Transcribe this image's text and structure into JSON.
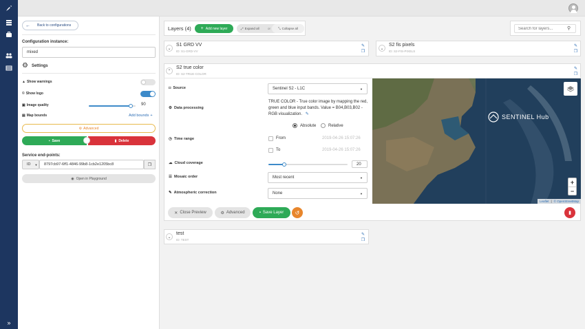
{
  "nav": {
    "icons": [
      "rocket-icon",
      "grid-icon",
      "briefcase-icon",
      "users-icon",
      "table-icon",
      "double-chevron-right-icon"
    ]
  },
  "left": {
    "back_label": "Back to configurations",
    "config_label": "Configuration instance:",
    "config_value": "mixed",
    "settings_label": "Settings",
    "show_warnings": "Show warnings",
    "show_logo": "Show logo",
    "image_quality": "Image quality",
    "image_quality_value": "90",
    "image_quality_fraction": 0.9,
    "map_bounds": "Map bounds",
    "add_bounds": "Add bounds",
    "advanced": "Advanced",
    "save": "Save",
    "delete": "Delete",
    "endpoints_label": "Service end-points:",
    "endpoint_type": "ID",
    "endpoint_value": "8797cb97-6ff1-4846-99b8-1cb2e1205bc8",
    "open_playground": "Open in Playground"
  },
  "header": {
    "layers_title": "Layers (4)",
    "add_layer": "Add new layer",
    "expand_all": "Expand all",
    "or": "or",
    "collapse_all": "Collapse all",
    "search_placeholder": "Search for layers..."
  },
  "layers": [
    {
      "title": "S1 GRD VV",
      "id": "ID: S1-GRD-VV"
    },
    {
      "title": "S2 fis pixels",
      "id": "ID: S2-FIS-PIXELS"
    },
    {
      "title": "S2 true color",
      "id": "ID: S2-TRUE-COLOR"
    },
    {
      "title": "test",
      "id": "ID: TEST"
    }
  ],
  "detail": {
    "source_label": "Source",
    "source_value": "Sentinel S2 - L1C",
    "data_processing_label": "Data processing",
    "data_processing_text": "TRUE COLOR - True color image by mapping the red, green and blue input bands. Value = B04,B03,B02 - RGB visualization.",
    "absolute": "Absolute",
    "relative": "Relative",
    "time_range_label": "Time range",
    "from_label": "From",
    "from_value": "2019-04-26 15:07:26",
    "to_label": "To",
    "to_value": "2019-04-26 15:07:26",
    "cloud_label": "Cloud coverage",
    "cloud_value": "20",
    "cloud_fraction": 0.2,
    "mosaic_label": "Mosaic order",
    "mosaic_value": "Most recent",
    "atmos_label": "Atmospheric correction",
    "atmos_value": "None",
    "close_preview": "Close Preview",
    "advanced": "Advanced",
    "save_layer": "Save Layer"
  },
  "map": {
    "brand": "SENTINEL Hub",
    "zoom_in": "+",
    "zoom_out": "−",
    "attr_leaflet": "Leaflet",
    "attr_osm": "© OpenStreetMap"
  },
  "colors": {
    "nav": "#1d3660",
    "green": "#2eaa57",
    "red": "#d9333b",
    "orange": "#e8862c",
    "blue": "#3d8ac9"
  }
}
